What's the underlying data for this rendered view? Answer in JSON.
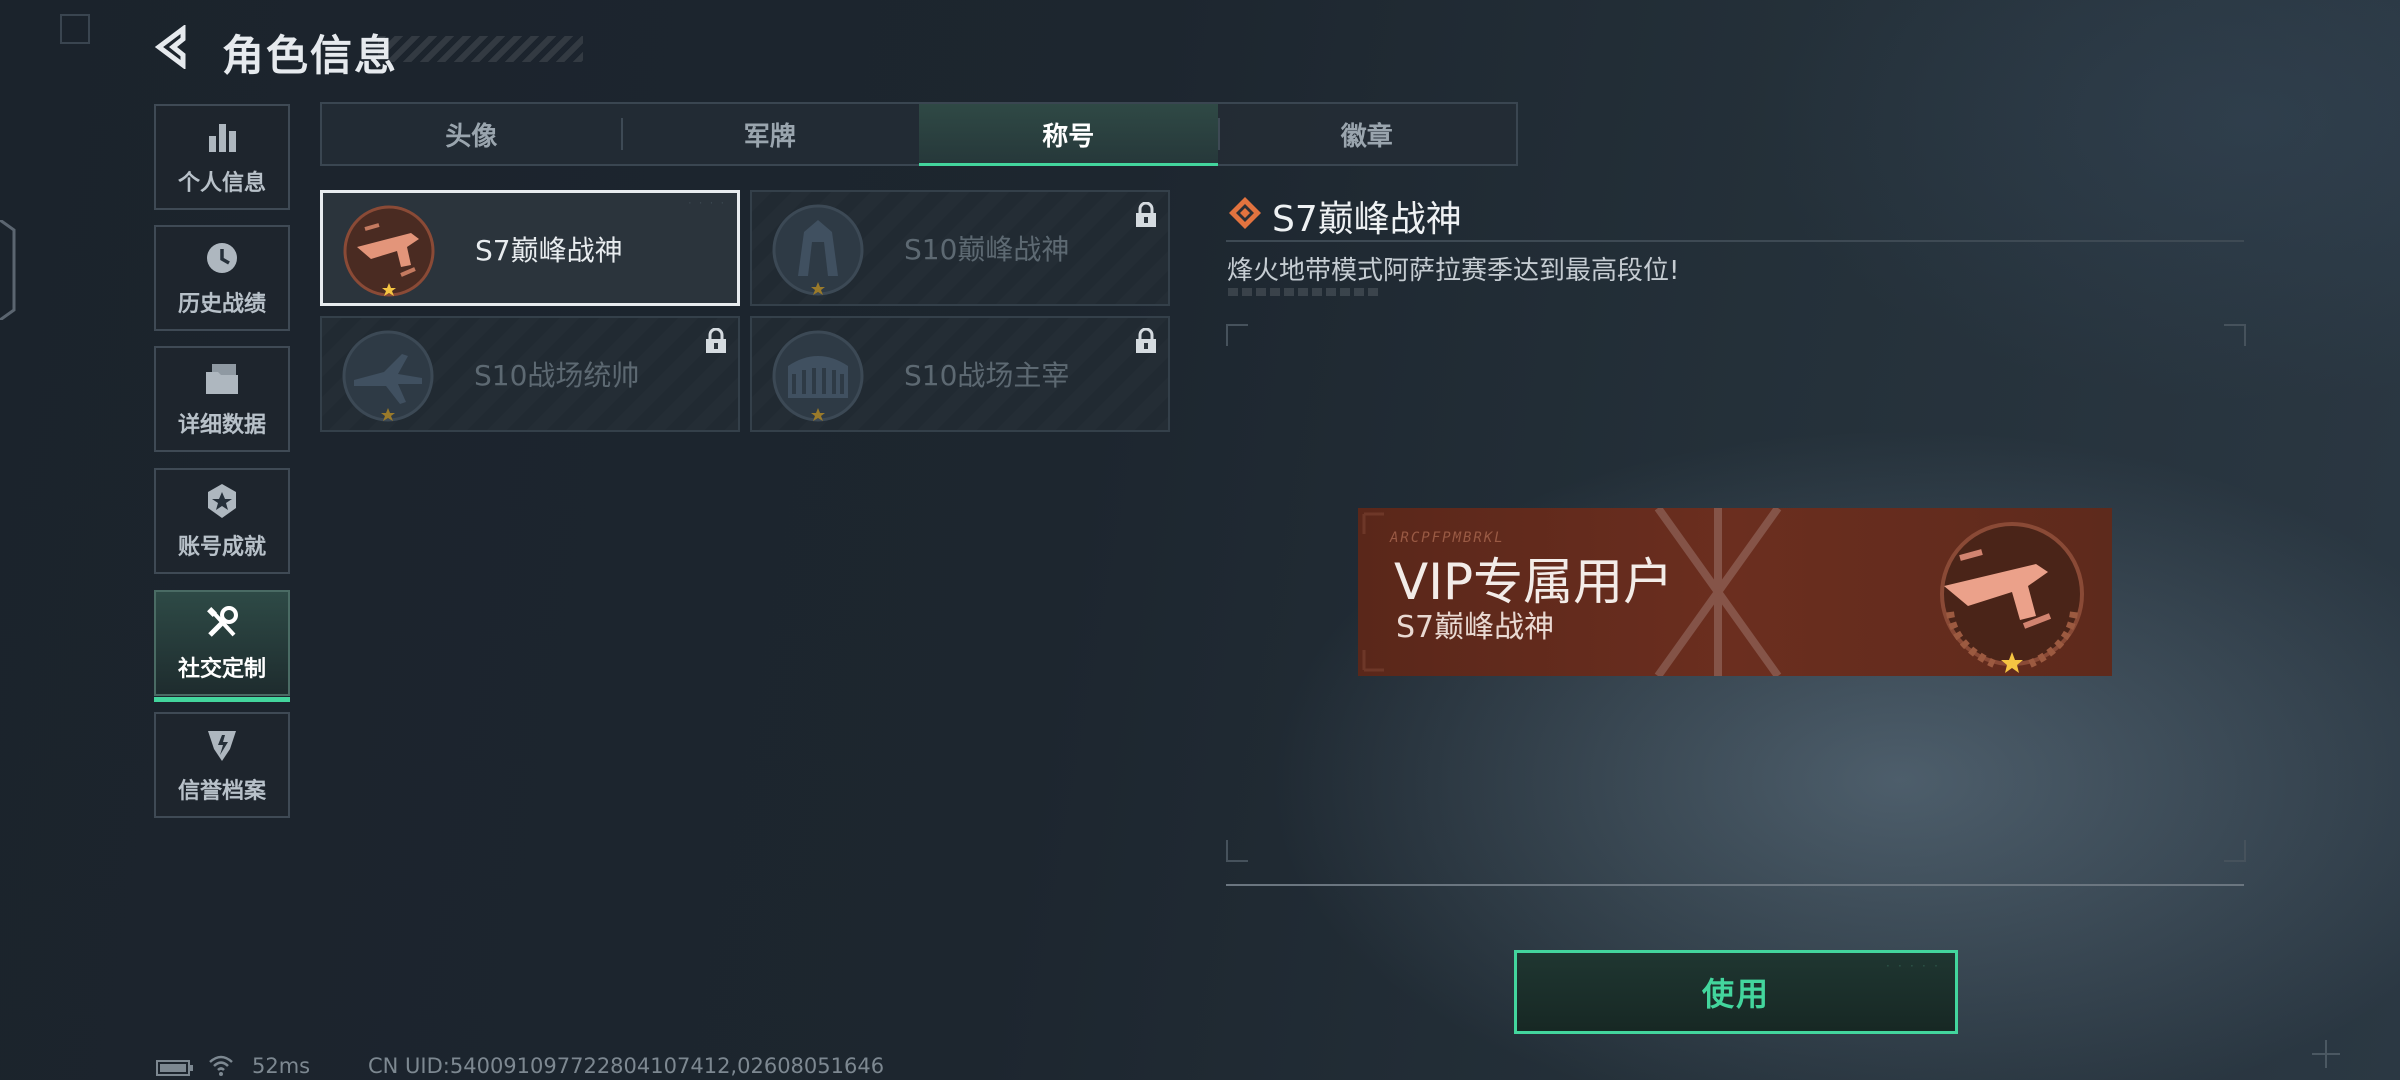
{
  "header": {
    "title": "角色信息",
    "back_icon": "back-arrow-icon"
  },
  "sidebar": {
    "items": [
      {
        "label": "个人信息",
        "icon": "bar-chart-icon",
        "active": false
      },
      {
        "label": "历史战绩",
        "icon": "clock-icon",
        "active": false
      },
      {
        "label": "详细数据",
        "icon": "folder-icon",
        "active": false
      },
      {
        "label": "账号成就",
        "icon": "achievement-badge-icon",
        "active": false
      },
      {
        "label": "社交定制",
        "icon": "tools-icon",
        "active": true
      },
      {
        "label": "信誉档案",
        "icon": "shield-emblem-icon",
        "active": false
      }
    ]
  },
  "tabs": [
    {
      "label": "头像",
      "active": false
    },
    {
      "label": "军牌",
      "active": false
    },
    {
      "label": "称号",
      "active": true
    },
    {
      "label": "徽章",
      "active": false
    }
  ],
  "titles": [
    {
      "name": "S7巅峰战神",
      "locked": false,
      "selected": true,
      "icon": "weapon-medal-icon"
    },
    {
      "name": "S10巅峰战神",
      "locked": true,
      "selected": false,
      "icon": "tower-medal-icon"
    },
    {
      "name": "S10战场统帅",
      "locked": true,
      "selected": false,
      "icon": "aircraft-medal-icon"
    },
    {
      "name": "S10战场主宰",
      "locked": true,
      "selected": false,
      "icon": "colosseum-medal-icon"
    }
  ],
  "detail": {
    "title": "S7巅峰战神",
    "description": "烽火地带模式阿萨拉赛季达到最高段位!",
    "icon": "diamond-emblem-icon"
  },
  "banner": {
    "title": "VIP专属用户",
    "subtitle": "S7巅峰战神",
    "code_text": "ARCPFPMBRKL"
  },
  "actions": {
    "use_label": "使用"
  },
  "status": {
    "ping": "52ms",
    "uid": "CN UID:540091097722804107412,02608051646"
  },
  "colors": {
    "accent": "#43d59d",
    "banner_bg": "#6b2e1f",
    "medal": "#e08a6a"
  }
}
